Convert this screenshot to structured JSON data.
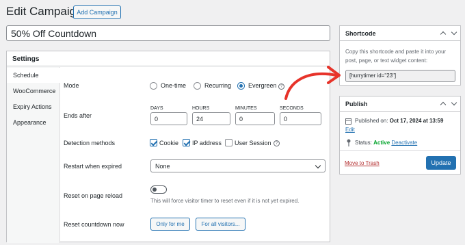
{
  "header": {
    "title": "Edit Campaign",
    "add_button": "Add Campaign"
  },
  "campaign": {
    "name": "50% Off Countdown"
  },
  "settings": {
    "title": "Settings",
    "tabs": [
      "Schedule",
      "WooCommerce",
      "Expiry Actions",
      "Appearance"
    ],
    "active_tab": "Schedule",
    "mode": {
      "label": "Mode",
      "options": [
        "One-time",
        "Recurring",
        "Evergreen"
      ],
      "selected": "Evergreen"
    },
    "ends_after": {
      "label": "Ends after",
      "fields": [
        {
          "label": "DAYS",
          "value": "0"
        },
        {
          "label": "HOURS",
          "value": "24"
        },
        {
          "label": "MINUTES",
          "value": "0"
        },
        {
          "label": "SECONDS",
          "value": "0"
        }
      ]
    },
    "detection": {
      "label": "Detection methods",
      "options": [
        {
          "label": "Cookie",
          "checked": true
        },
        {
          "label": "IP address",
          "checked": true
        },
        {
          "label": "User Session",
          "checked": false
        }
      ]
    },
    "restart": {
      "label": "Restart when expired",
      "value": "None"
    },
    "reset_reload": {
      "label": "Reset on page reload",
      "enabled": false,
      "note": "This will force visitor timer to reset even if it is not yet expired."
    },
    "reset_now": {
      "label": "Reset countdown now",
      "btn_me": "Only for me",
      "btn_all": "For all visitors..."
    }
  },
  "shortcode": {
    "title": "Shortcode",
    "description": "Copy this shortcode and paste it into your post, page, or text widget content:",
    "code": "[hurrytimer id=\"23\"]"
  },
  "publish": {
    "title": "Publish",
    "published_label": "Published on:",
    "published_date": "Oct 17, 2024 at 13:59",
    "edit": "Edit",
    "status_label": "Status:",
    "status_value": "Active",
    "deactivate": "Deactivate",
    "trash": "Move to Trash",
    "update": "Update"
  },
  "colors": {
    "accent": "#2271b1",
    "annotation": "#e7332a",
    "active_status": "#00a32a"
  }
}
